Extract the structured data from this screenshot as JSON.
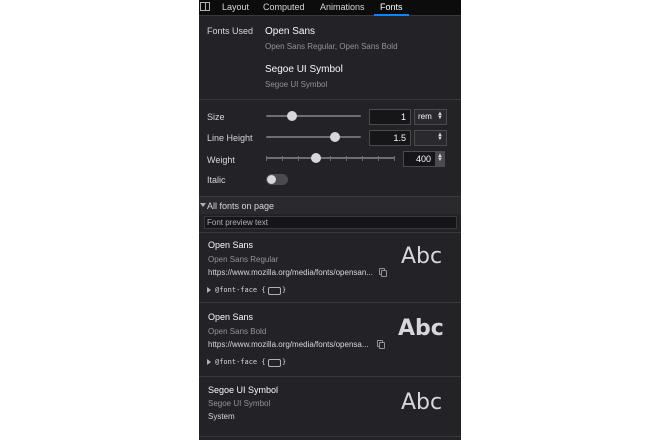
{
  "colors": {
    "panel_bg": "#232327",
    "tab_bg": "#0c0c0d",
    "accent": "#0a84ff",
    "text": "#d7d7db",
    "dim_text": "#939395"
  },
  "tabs": [
    {
      "label": "Layout"
    },
    {
      "label": "Computed"
    },
    {
      "label": "Animations"
    },
    {
      "label": "Fonts",
      "active": true
    }
  ],
  "fonts_used": {
    "label": "Fonts Used",
    "groups": [
      {
        "name": "Open Sans",
        "styles": "Open Sans Regular,  Open Sans Bold"
      },
      {
        "name": "Segoe UI Symbol",
        "styles": "Segoe UI Symbol"
      }
    ]
  },
  "controls": {
    "size": {
      "label": "Size",
      "value": "1",
      "unit": "rem",
      "slider_fraction": 0.26
    },
    "line_height": {
      "label": "Line Height",
      "value": "1.5",
      "slider_fraction": 0.74
    },
    "weight": {
      "label": "Weight",
      "value": "400",
      "slider_fraction": 0.38
    },
    "italic": {
      "label": "Italic",
      "enabled": false
    }
  },
  "all_fonts": {
    "header": "All fonts on page",
    "preview_text": "Font preview text",
    "items": [
      {
        "name": "Open Sans",
        "style": "Open Sans Regular",
        "url": "https://www.mozilla.org/media/fonts/opensan...",
        "fontface": "@font-face {",
        "preview": "Abc",
        "bold": false,
        "icon": "copy-icon"
      },
      {
        "name": "Open Sans",
        "style": "Open Sans Bold",
        "url": "https://www.mozilla.org/media/fonts/opensa...",
        "fontface": "@font-face {",
        "preview": "Abc",
        "bold": true,
        "icon": "copy-icon"
      },
      {
        "name": "Segoe UI Symbol",
        "style": "Segoe UI Symbol",
        "source": "System",
        "preview": "Abc",
        "bold": false
      }
    ]
  }
}
